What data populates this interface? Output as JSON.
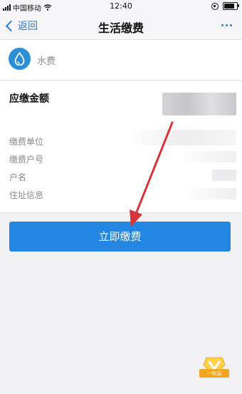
{
  "status_bar": {
    "carrier": "中国移动",
    "time": "12:40"
  },
  "nav": {
    "back_label": "返回",
    "title": "生活缴费"
  },
  "service": {
    "name": "水费",
    "icon": "water-drop-icon",
    "icon_color": "#2b8fd8"
  },
  "details": {
    "amount_label": "应缴金额",
    "fields": [
      "缴费单位",
      "缴费户号",
      "户名",
      "住址信息"
    ]
  },
  "pay_button": {
    "label": "立即缴费",
    "color": "#2486e3"
  },
  "badge": {
    "label": "一权益"
  },
  "annotation": {
    "color": "#d8333a"
  }
}
